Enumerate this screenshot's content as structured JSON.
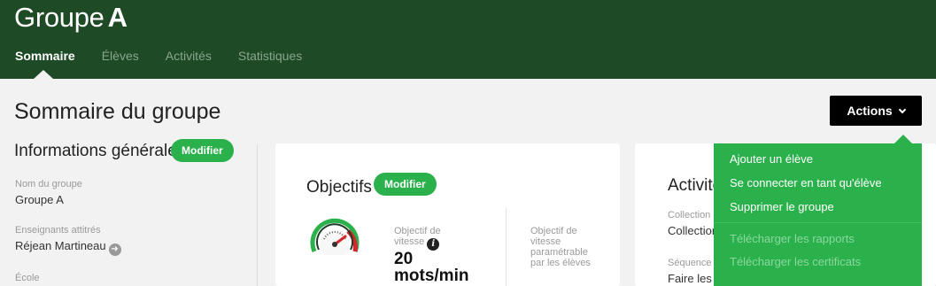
{
  "header": {
    "group_prefix": "Groupe",
    "group_name": "A",
    "tabs": [
      {
        "label": "Sommaire",
        "active": true
      },
      {
        "label": "Élèves",
        "active": false
      },
      {
        "label": "Activités",
        "active": false
      },
      {
        "label": "Statistiques",
        "active": false
      }
    ]
  },
  "page": {
    "title": "Sommaire du groupe",
    "actions_label": "Actions"
  },
  "general": {
    "heading": "Informations générales",
    "modify_label": "Modifier",
    "fields": [
      {
        "label": "Nom du groupe",
        "value": "Groupe A"
      },
      {
        "label": "Enseignants attitrés",
        "value": "Réjean Martineau"
      },
      {
        "label": "École",
        "value": ""
      }
    ]
  },
  "objectives": {
    "heading": "Objectifs",
    "modify_label": "Modifier",
    "speed_label": "Objectif de vitesse",
    "speed_value": "20 mots/min",
    "param_label": "Objectif de vitesse paramétrable par les élèves"
  },
  "activities": {
    "heading": "Activités",
    "collection_label": "Collection",
    "collection_value": "Collection",
    "sequence_label": "Séquence",
    "sequence_value": "Faire les a"
  },
  "menu": {
    "items": [
      {
        "label": "Ajouter un élève",
        "enabled": true
      },
      {
        "label": "Se connecter en tant qu'élève",
        "enabled": true
      },
      {
        "label": "Supprimer le groupe",
        "enabled": true
      },
      {
        "label": "Télécharger les rapports",
        "enabled": false
      },
      {
        "label": "Télécharger les certificats",
        "enabled": false
      }
    ]
  },
  "colors": {
    "header_bg": "#1e4a25",
    "accent_green": "#2bb14c",
    "actions_bg": "#000000"
  }
}
